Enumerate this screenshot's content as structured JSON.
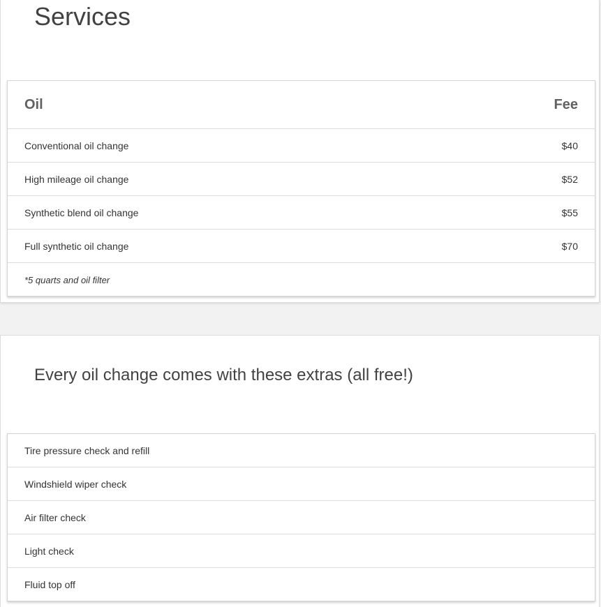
{
  "page": {
    "title": "Services"
  },
  "oil_table": {
    "header_service": "Oil",
    "header_fee": "Fee",
    "rows": [
      {
        "service": "Conventional oil change",
        "fee": "$40"
      },
      {
        "service": "High mileage oil change",
        "fee": "$52"
      },
      {
        "service": "Synthetic blend oil change",
        "fee": "$55"
      },
      {
        "service": "Full synthetic oil change",
        "fee": "$70"
      }
    ],
    "note": "*5 quarts and oil filter"
  },
  "extras": {
    "title": "Every oil change comes with these extras (all free!)",
    "items": [
      "Tire pressure check and refill",
      "Windshield wiper check",
      "Air filter check",
      "Light check",
      "Fluid top off"
    ]
  }
}
